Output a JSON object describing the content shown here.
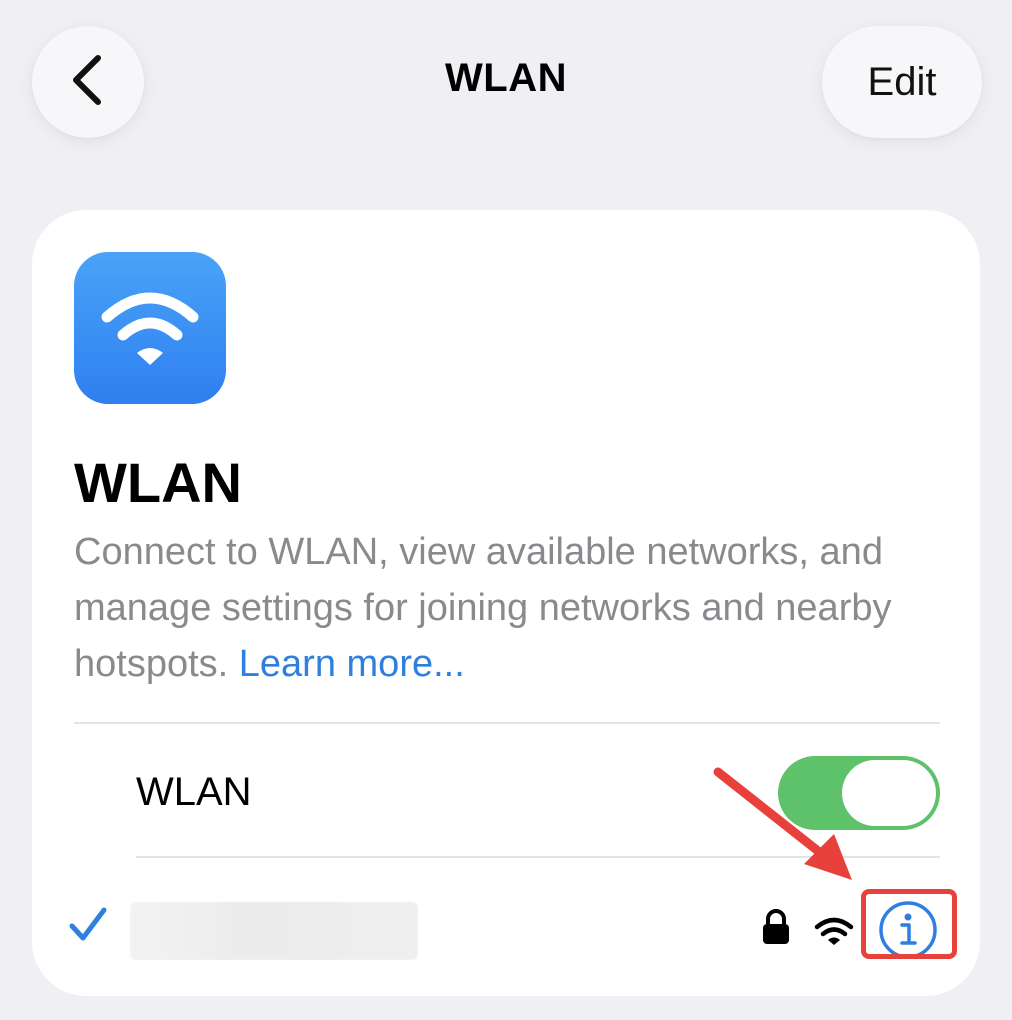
{
  "nav": {
    "title": "WLAN",
    "edit_label": "Edit",
    "back_icon": "chevron-left-icon"
  },
  "card": {
    "icon": "wifi-icon",
    "title": "WLAN",
    "description": "Connect to WLAN, view available networks, and manage settings for joining networks and nearby hotspots.",
    "learn_more": "Learn more..."
  },
  "toggle_row": {
    "label": "WLAN",
    "enabled": true
  },
  "network_row": {
    "connected_icon": "checkmark-icon",
    "secured_icon": "lock-icon",
    "signal_icon": "wifi-signal-icon",
    "info_icon": "info-icon"
  },
  "colors": {
    "accent": "#2f7fe0",
    "toggle_on": "#5ec26a",
    "annotation": "#e8403a",
    "background": "#efeff4"
  }
}
